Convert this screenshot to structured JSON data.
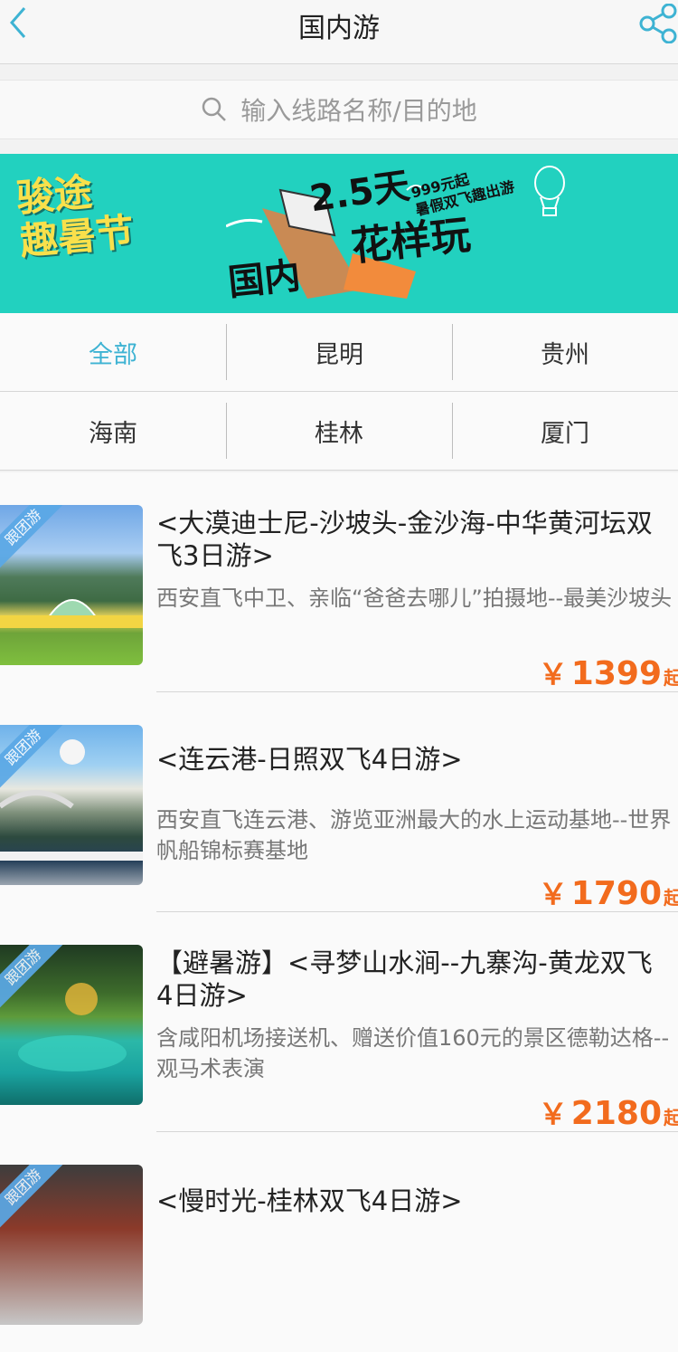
{
  "header": {
    "title": "国内游",
    "back_icon": "chevron-left-icon",
    "share_icon": "share-icon",
    "accent": "#3eb3d3"
  },
  "search": {
    "placeholder": "输入线路名称/目的地"
  },
  "banner": {
    "logo_line1": "骏途",
    "logo_line2": "趣暑节",
    "headline1": "2.5天",
    "headline2": "花样玩",
    "promo": "999元起\n暑假双飞趣出游",
    "tag": "国内"
  },
  "filters": [
    [
      "全部",
      "昆明",
      "贵州"
    ],
    [
      "海南",
      "桂林",
      "厦门"
    ]
  ],
  "items": [
    {
      "ribbon": "跟团游",
      "title": "<大漠迪士尼-沙坡头-金沙海-中华黄河坛双飞3日游>",
      "desc": "西安直飞中卫、亲临“爸爸去哪儿”拍摄地--最美沙坡头",
      "currency": "￥",
      "price": "1399",
      "suffix": "起"
    },
    {
      "ribbon": "跟团游",
      "title": "<连云港-日照双飞4日游>",
      "desc": "西安直飞连云港、游览亚洲最大的水上运动基地--世界帆船锦标赛基地",
      "currency": "￥",
      "price": "1790",
      "suffix": "起"
    },
    {
      "ribbon": "跟团游",
      "title": "【避暑游】<寻梦山水涧--九寨沟-黄龙双飞4日游>",
      "desc": "含咸阳机场接送机、赠送价值160元的景区德勒达格--观马术表演",
      "currency": "￥",
      "price": "2180",
      "suffix": "起"
    },
    {
      "ribbon": "跟团游",
      "title": "<慢时光-桂林双飞4日游>",
      "desc": "",
      "currency": "",
      "price": "",
      "suffix": ""
    }
  ]
}
